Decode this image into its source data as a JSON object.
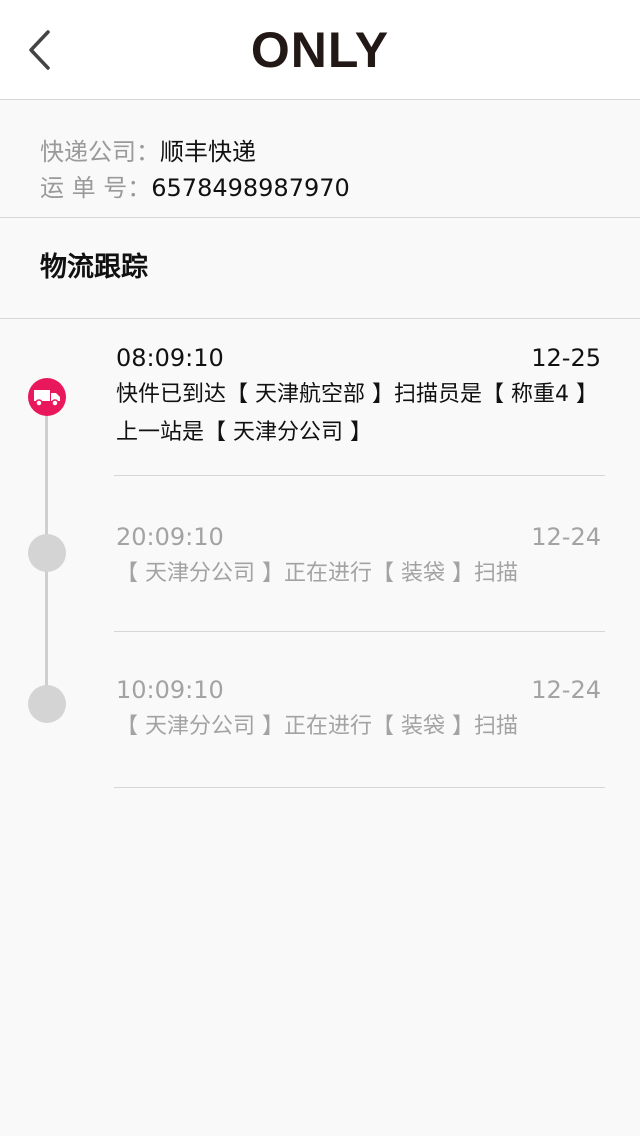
{
  "header": {
    "brand": "ONLY",
    "back_icon": "chevron-left-icon"
  },
  "shipment": {
    "carrier_label": "快递公司：",
    "carrier_value": "顺丰快递",
    "tracking_label": "运 单 号：",
    "tracking_value": "6578498987970"
  },
  "section": {
    "title": "物流跟踪"
  },
  "tracking": {
    "accent_color": "#e9175c",
    "current_icon": "truck-icon",
    "events": [
      {
        "time": "08:09:10",
        "date": "12-25",
        "desc_line1": "快件已到达【 天津航空部 】扫描员是【 称重4 】",
        "desc_line2": "上一站是【 天津分公司 】"
      },
      {
        "time": "20:09:10",
        "date": "12-24",
        "desc_line1": "【 天津分公司 】正在进行【 装袋 】扫描"
      },
      {
        "time": "10:09:10",
        "date": "12-24",
        "desc_line1": "【 天津分公司 】正在进行【 装袋 】扫描"
      }
    ]
  }
}
